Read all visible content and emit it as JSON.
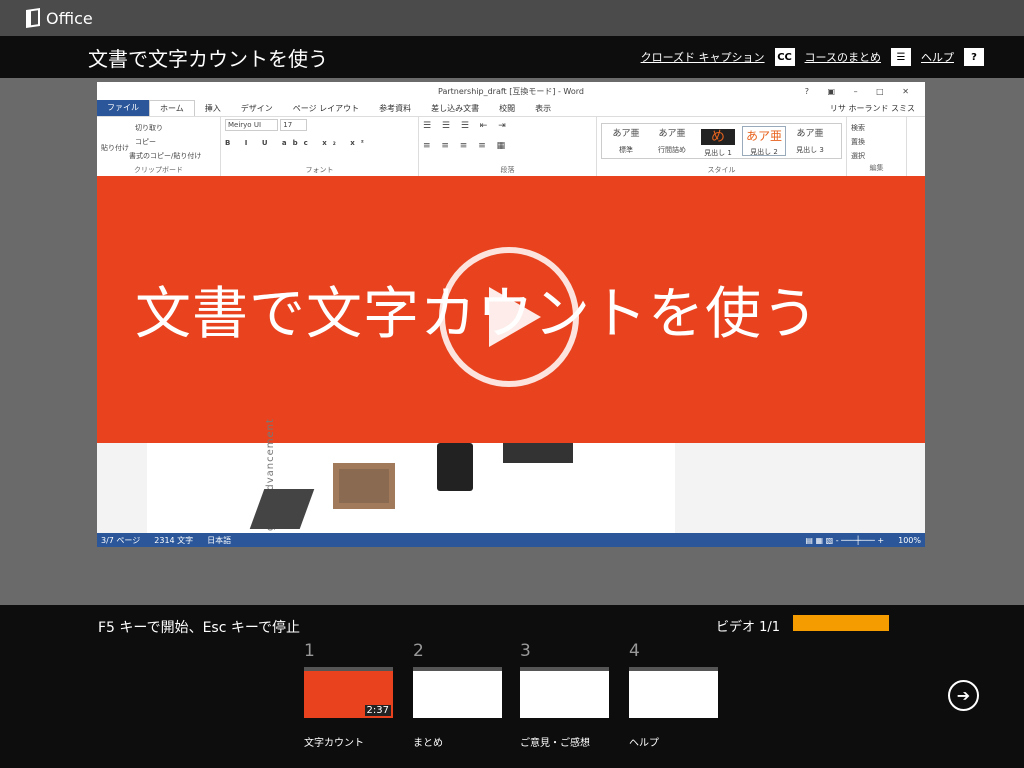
{
  "app": {
    "name": "Office"
  },
  "header": {
    "title": "文書で文字カウントを使う",
    "links": [
      {
        "label": "クローズド キャプション",
        "icon": "CC"
      },
      {
        "label": "コースのまとめ",
        "icon": "☰"
      },
      {
        "label": "ヘルプ",
        "icon": "?"
      }
    ]
  },
  "word": {
    "title": "Partnership_draft [互換モード] - Word",
    "tabs": [
      "ファイル",
      "ホーム",
      "挿入",
      "デザイン",
      "ページ レイアウト",
      "参考資料",
      "差し込み文書",
      "校閲",
      "表示"
    ],
    "user": "リサ ホーランド スミス",
    "clipboard": {
      "paste": "貼り付け",
      "cut": "切り取り",
      "copy": "コピー",
      "format": "書式のコピー/貼り付け",
      "label": "クリップボード"
    },
    "font": {
      "name": "Meiryo UI",
      "size": "17",
      "label": "フォント"
    },
    "paragraph_label": "段落",
    "styles": [
      {
        "sample": "あア亜",
        "name": "標準"
      },
      {
        "sample": "あア亜",
        "name": "行間詰め"
      },
      {
        "sample": "め",
        "name": "見出し 1"
      },
      {
        "sample": "あア亜",
        "name": "見出し 2"
      },
      {
        "sample": "あア亜",
        "name": "見出し 3"
      }
    ],
    "styles_label": "スタイル",
    "edit": {
      "find": "検索",
      "replace": "置換",
      "select": "選択",
      "label": "編集"
    },
    "doc_text": "gical Advancement",
    "status": {
      "page": "3/7 ページ",
      "words": "2314 文字",
      "lang": "日本語",
      "zoom": "100%"
    }
  },
  "video": {
    "overlay_title": "文書で文字カウントを使う"
  },
  "footer": {
    "hint": "F5 キーで開始、Esc キーで停止",
    "video_counter": "ビデオ 1/1",
    "progress": 1.0,
    "progress_color": "#f59c00",
    "chapters": [
      {
        "num": "1",
        "label": "文字カウント",
        "duration": "2:37"
      },
      {
        "num": "2",
        "label": "まとめ"
      },
      {
        "num": "3",
        "label": "ご意見・ご感想"
      },
      {
        "num": "4",
        "label": "ヘルプ"
      }
    ]
  }
}
